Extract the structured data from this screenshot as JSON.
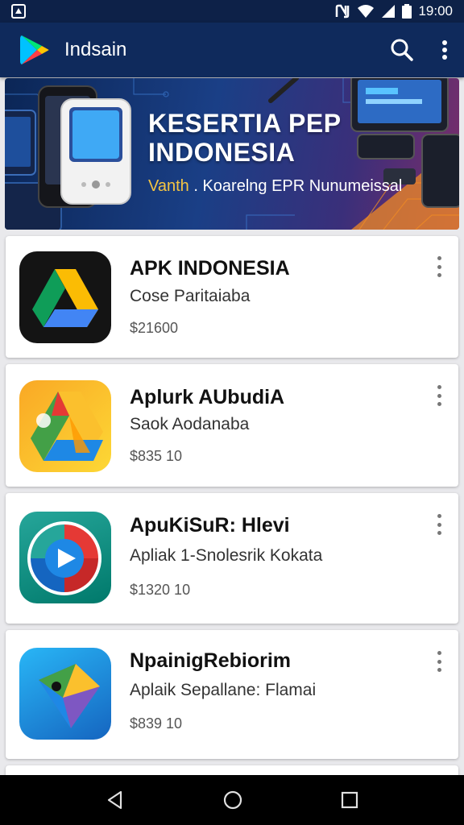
{
  "status_bar": {
    "time": "19:00"
  },
  "app_bar": {
    "title": "Indsain"
  },
  "banner": {
    "title_line1": "KESERTIA PEP",
    "title_line2": "INDONESIA",
    "subtitle_highlight": "Vanth",
    "subtitle_rest": " . Koarelng EPR Nunumeissal"
  },
  "apps": [
    {
      "name": "APK INDONESIA",
      "subtitle": "Cose Paritaiaba",
      "price": "$21600"
    },
    {
      "name": "Aplurk AUbudiA",
      "subtitle": "Saok Aodanaba",
      "price": "$835 10"
    },
    {
      "name": "ApuKiSuR: Hlevi",
      "subtitle": "Apliak 1-Snolesrik Kokata",
      "price": "$1320 10"
    },
    {
      "name": "NpainigRebiorim",
      "subtitle": "Aplaik Sepallane: Flamai",
      "price": "$839 10"
    }
  ],
  "colors": {
    "status_bar": "#0d2148",
    "app_bar": "#0f2a5c",
    "nav_bar": "#000000",
    "banner_accent": "#f5c542"
  },
  "icons": [
    "warning-icon",
    "nfc-icon",
    "wifi-icon",
    "signal-icon",
    "battery-icon",
    "play-store-logo-icon",
    "search-icon",
    "overflow-menu-icon",
    "back-icon",
    "home-icon",
    "recents-icon"
  ]
}
